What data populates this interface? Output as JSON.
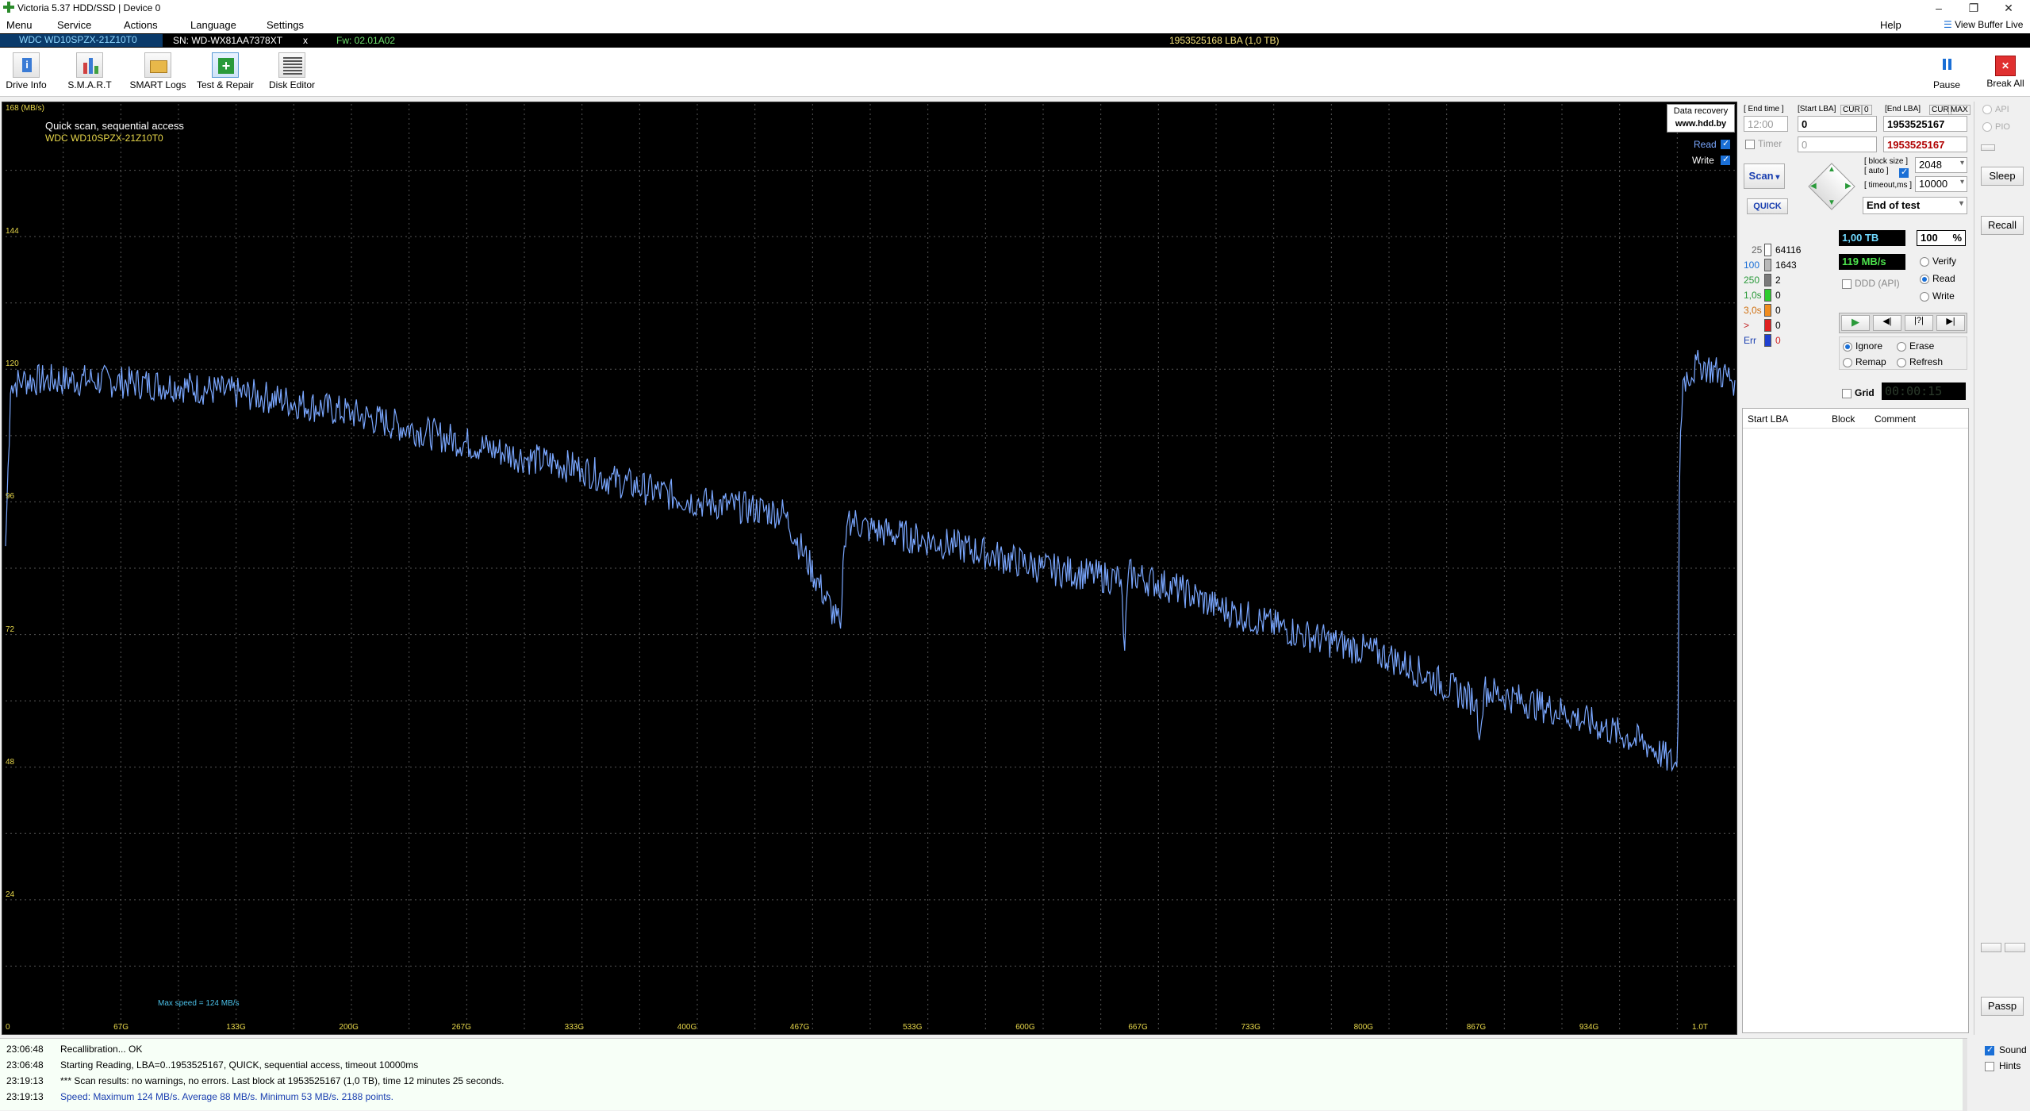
{
  "window": {
    "title": "Victoria 5.37 HDD/SSD | Device 0"
  },
  "menu": {
    "items": [
      "Menu",
      "Service",
      "Actions",
      "Language",
      "Settings"
    ],
    "help": "Help",
    "view_buffer": "View Buffer Live"
  },
  "device": {
    "model": "WDC WD10SPZX-21Z10T0",
    "serial": "SN: WD-WX81AA7378XT",
    "close_mark": "x",
    "firmware": "Fw: 02.01A02",
    "capacity": "1953525168 LBA (1,0 TB)"
  },
  "toolbar": {
    "drive_info": "Drive Info",
    "smart": "S.M.A.R.T",
    "smart_logs": "SMART Logs",
    "test_repair": "Test & Repair",
    "disk_editor": "Disk Editor",
    "pause": "Pause",
    "break_all": "Break All"
  },
  "graph": {
    "unit": "168 (MB/s)",
    "title": "Quick scan, sequential access",
    "subtitle": "WDC WD10SPZX-21Z10T0",
    "recovery_line1": "Data recovery",
    "recovery_line2": "www.hdd.by",
    "read_label": "Read",
    "write_label": "Write",
    "max_speed": "Max speed = 124 MB/s",
    "y_ticks": [
      "144",
      "120",
      "96",
      "72",
      "48",
      "24"
    ],
    "x_ticks": [
      "0",
      "67G",
      "133G",
      "200G",
      "267G",
      "333G",
      "400G",
      "467G",
      "533G",
      "600G",
      "667G",
      "733G",
      "800G",
      "867G",
      "934G",
      "1.0T"
    ],
    "colors": {
      "line": "#7aa7ff",
      "grid": "#555555",
      "label": "#e8d84a"
    }
  },
  "chart_data": {
    "type": "line",
    "title": "Quick scan, sequential access",
    "subtitle": "WDC WD10SPZX-21Z10T0",
    "xlabel": "",
    "ylabel": "(MB/s)",
    "ylim": [
      0,
      168
    ],
    "xlim": [
      0,
      1000
    ],
    "x_tick_labels": [
      "0",
      "67G",
      "133G",
      "200G",
      "267G",
      "333G",
      "400G",
      "467G",
      "533G",
      "600G",
      "667G",
      "733G",
      "800G",
      "867G",
      "934G",
      "1.0T"
    ],
    "grid": true,
    "series": [
      {
        "name": "Read",
        "x": [
          0,
          3,
          10,
          50,
          100,
          150,
          200,
          250,
          300,
          333,
          350,
          400,
          450,
          483,
          485,
          487,
          500,
          550,
          600,
          645,
          647,
          649,
          680,
          700,
          750,
          800,
          850,
          853,
          855,
          900,
          950,
          967,
          968,
          970,
          980,
          1000
        ],
        "y": [
          88,
          117,
          118,
          118,
          117,
          115,
          112,
          108,
          104,
          102,
          100,
          96,
          94,
          73,
          88,
          93,
          91,
          88,
          84,
          82,
          68,
          83,
          80,
          77,
          72,
          68,
          60,
          54,
          62,
          58,
          52,
          48,
          105,
          118,
          121,
          118
        ]
      }
    ]
  },
  "panel": {
    "end_time_label": "[ End time ]",
    "end_time_value": "12:00",
    "start_lba_label": "[Start LBA]",
    "cur_label": "CUR",
    "cur_value": "0",
    "start_lba_value": "0",
    "end_lba_label": "[End LBA]",
    "end_cur": "CUR",
    "end_max": "MAX",
    "end_lba_value": "1953525167",
    "end_lba_value2": "1953525167",
    "timer_label": "Timer",
    "timer_value": "0",
    "scan_label": "Scan",
    "quick_label": "QUICK",
    "block_size_label": "[ block size ]",
    "auto_label": "[ auto ]",
    "block_size_value": "2048",
    "timeout_label": "[ timeout,ms ]",
    "timeout_value": "10000",
    "end_of_test": "End of test",
    "blocks": [
      {
        "label": "25",
        "value": "64116",
        "color": "#ffffff"
      },
      {
        "label": "100",
        "value": "1643",
        "color": "#b8b8b8"
      },
      {
        "label": "250",
        "value": "2",
        "color": "#7a7a7a"
      },
      {
        "label": "1,0s",
        "value": "0",
        "color": "#2ecc2e"
      },
      {
        "label": "3,0s",
        "value": "0",
        "color": "#f08c1e"
      },
      {
        "label": ">",
        "value": "0",
        "color": "#e02020"
      },
      {
        "label": "Err",
        "value": "0",
        "color": "#2040d0"
      }
    ],
    "capacity": "1,00 TB",
    "percent": "100",
    "percent_sign": "%",
    "speed": "119 MB/s",
    "ddd_api": "DDD (API)",
    "verify": "Verify",
    "read": "Read",
    "write": "Write",
    "ignore": "Ignore",
    "erase": "Erase",
    "remap": "Remap",
    "refresh": "Refresh",
    "grid": "Grid",
    "timer_display": "00:00:15",
    "table_headers": [
      "Start LBA",
      "Block",
      "Comment"
    ]
  },
  "right": {
    "api": "API",
    "pio": "PIO",
    "sleep": "Sleep",
    "recall": "Recall",
    "passp": "Passp",
    "sound": "Sound",
    "hints": "Hints"
  },
  "log": [
    {
      "time": "23:06:48",
      "text": "Recallibration... OK",
      "color": "#000000"
    },
    {
      "time": "23:06:48",
      "text": "Starting Reading, LBA=0..1953525167, QUICK, sequential access, timeout 10000ms",
      "color": "#000000"
    },
    {
      "time": "23:19:13",
      "text": "*** Scan results: no warnings, no errors. Last block at 1953525167 (1,0 TB), time 12 minutes 25 seconds.",
      "color": "#000000"
    },
    {
      "time": "23:19:13",
      "text": "Speed: Maximum 124 MB/s. Average 88 MB/s. Minimum 53 MB/s. 2188 points.",
      "color": "#1a3fb0"
    }
  ]
}
